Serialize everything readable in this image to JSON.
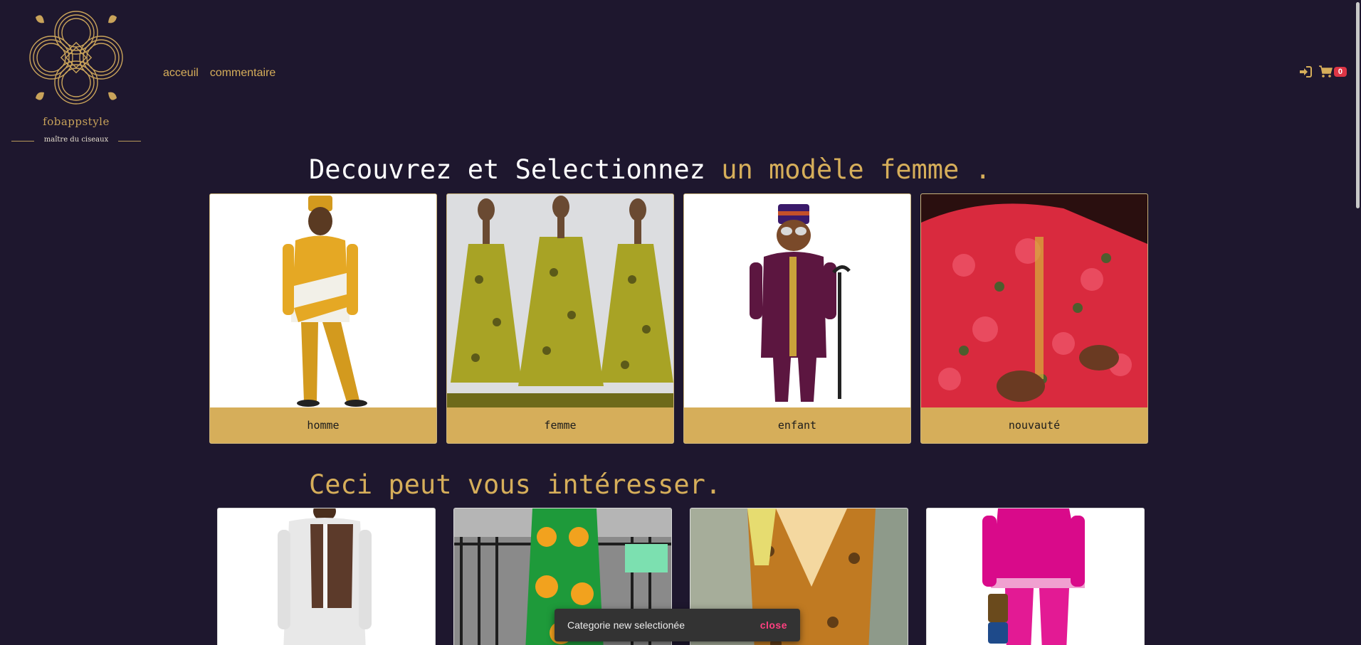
{
  "brand": {
    "name": "fobappstyle",
    "tagline": "maître du ciseaux"
  },
  "nav": {
    "items": [
      {
        "label": "acceuil"
      },
      {
        "label": "commentaire"
      }
    ]
  },
  "header": {
    "login_icon": "sign-in-icon",
    "cart_icon": "cart-icon",
    "cart_count": "0"
  },
  "section1": {
    "heading_white": "Decouvrez et Selectionnez ",
    "heading_gold": "un modèle femme ."
  },
  "categories": [
    {
      "label": "homme"
    },
    {
      "label": "femme"
    },
    {
      "label": "enfant"
    },
    {
      "label": "nouvauté"
    }
  ],
  "section2": {
    "heading": "Ceci peut vous intéresser."
  },
  "toast": {
    "message": "Categorie new selectionée",
    "action": "close"
  },
  "colors": {
    "background": "#1e172e",
    "accent": "#d6ae5a",
    "badge": "#dc3545",
    "toast_action": "#ff4081"
  }
}
